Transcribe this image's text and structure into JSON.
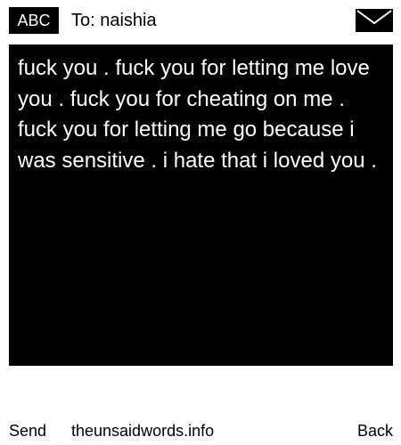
{
  "header": {
    "input_mode": "ABC",
    "recipient": "To: naishia",
    "icon": "envelope-icon"
  },
  "message": {
    "body": "fuck you . fuck you for letting me love you . fuck you for cheating on me . fuck you for letting me go because i was sensitive . i hate that i loved you ."
  },
  "softkeys": {
    "left": "Send",
    "center": "theunsaidwords.info",
    "right": "Back"
  },
  "colors": {
    "background": "#ffffff",
    "message_background": "#000000",
    "message_text": "#ffffff",
    "text": "#000000"
  }
}
